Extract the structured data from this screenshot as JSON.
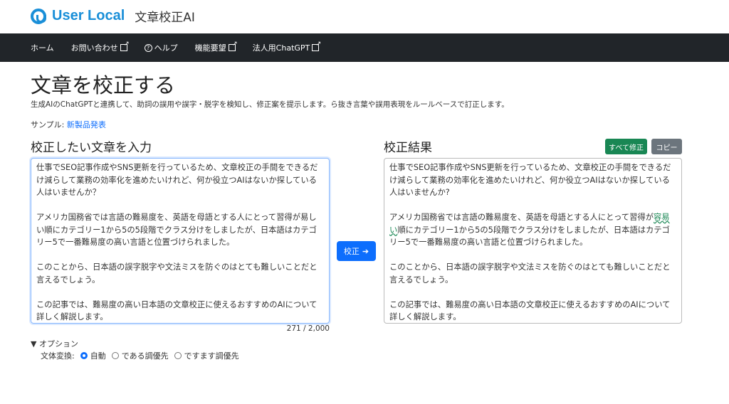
{
  "header": {
    "logo_text": "User Local",
    "app_name": "文章校正AI"
  },
  "nav": {
    "items": [
      {
        "label": "ホーム",
        "external": false
      },
      {
        "label": "お問い合わせ",
        "external": true
      },
      {
        "label": "ヘルプ",
        "icon": "question-circle-icon",
        "external": false
      },
      {
        "label": "機能要望",
        "external": true
      },
      {
        "label": "法人用ChatGPT",
        "external": true
      }
    ]
  },
  "page": {
    "title": "文章を校正する",
    "description": "生成AIのChatGPTと連携して、助詞の誤用や誤字・脱字を検知し、修正案を提示します。ら抜き言葉や誤用表現をルールベースで訂正します。",
    "sample_label": "サンプル:",
    "sample_link": "新製品発表"
  },
  "input": {
    "heading": "校正したい文章を入力",
    "paragraphs": [
      "仕事でSEO記事作成やSNS更新を行っているため、文章校正の手間をできるだけ減らして業務の効率化を進めたいけれど、何か役立つAIはないか探している人はいませんか？",
      "アメリカ国務省では言語の難易度を、英語を母語とする人にとって習得が易しい順にカテゴリー1から5の5段階でクラス分けをしましたが、日本語はカテゴリー5で一番難易度の高い言語と位置づけられました。",
      "このことから、日本語の誤字脱字や文法ミスを防ぐのはとても難しいことだと言えるでしょう。",
      "この記事では、難易度の高い日本語の文章校正に使えるおすすめのAIについて詳しく解説します。"
    ],
    "counter": "271 / 2,000"
  },
  "submit": {
    "label": "校正",
    "icon": "arrow-right-icon"
  },
  "output": {
    "heading": "校正結果",
    "fix_all": "すべて修正",
    "copy": "コピー",
    "p1": "仕事でSEO記事作成やSNS更新を行っているため、文章校正の手間をできるだけ減らして業務の効率化を進めたいけれど、何か役立つAIはないか探している人はいませんか?",
    "p2_before": "アメリカ国務省では言語の難易度を、英語を母語とする人にとって習得が",
    "p2_highlight": "容易い",
    "p2_after": "順にカテゴリー1から5の5段階でクラス分けをしましたが、日本語はカテゴリー5で一番難易度の高い言語と位置づけられました。",
    "p3": "このことから、日本語の誤字脱字や文法ミスを防ぐのはとても難しいことだと言えるでしょう。",
    "p4": "この記事では、難易度の高い日本語の文章校正に使えるおすすめのAIについて詳しく解説します。",
    "highlight_color": "#198754"
  },
  "options": {
    "toggle": "▼ オプション",
    "style_label": "文体変換:",
    "choices": [
      "自動",
      "である調優先",
      "ですます調優先"
    ],
    "selected": "自動"
  }
}
